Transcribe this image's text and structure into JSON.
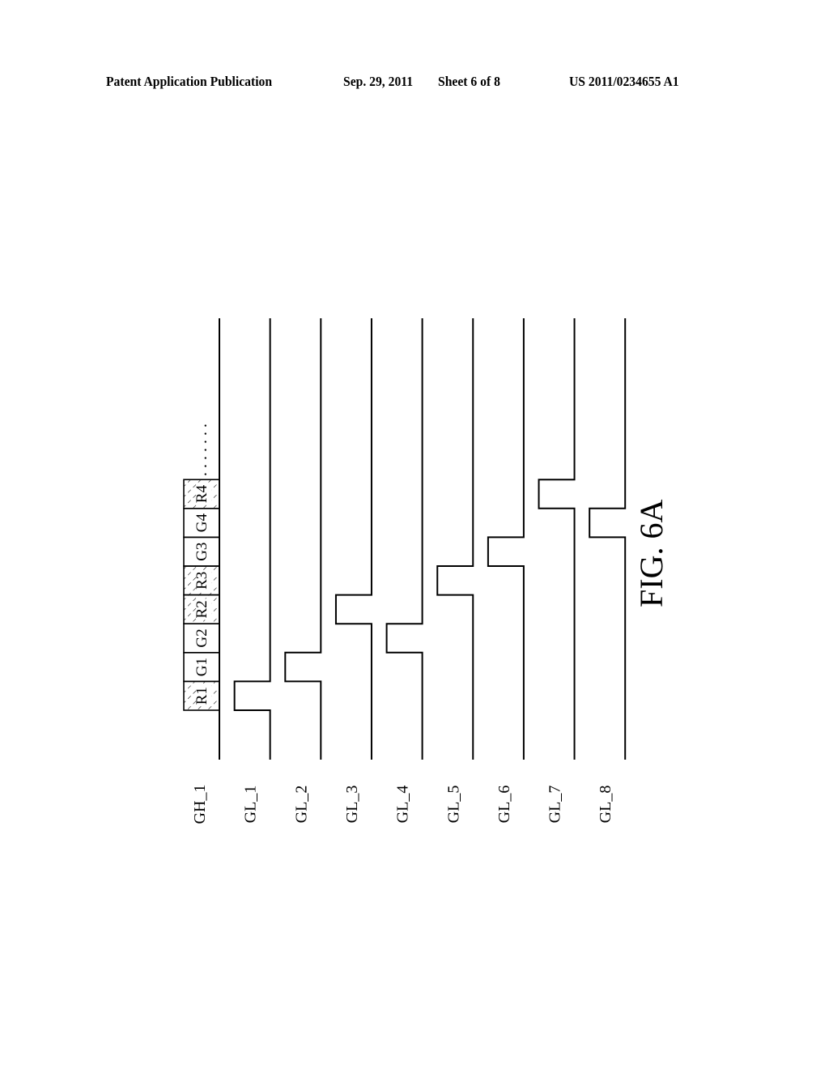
{
  "header": {
    "publication_type": "Patent Application Publication",
    "date": "Sep. 29, 2011",
    "sheet": "Sheet 6 of 8",
    "patent_number": "US 2011/0234655 A1"
  },
  "figure": {
    "caption": "FIG. 6A",
    "gh_slots": [
      {
        "label": "R1",
        "hatched": true
      },
      {
        "label": "G1",
        "hatched": false
      },
      {
        "label": "G2",
        "hatched": false
      },
      {
        "label": "R2",
        "hatched": true
      },
      {
        "label": "R3",
        "hatched": true
      },
      {
        "label": "G3",
        "hatched": false
      },
      {
        "label": "G4",
        "hatched": false
      },
      {
        "label": "R4",
        "hatched": true
      }
    ],
    "continuation": ".......",
    "signals": [
      {
        "name": "GH_1",
        "pulse_slot": null
      },
      {
        "name": "GL_1",
        "pulse_slot": 0
      },
      {
        "name": "GL_2",
        "pulse_slot": 1
      },
      {
        "name": "GL_3",
        "pulse_slot": 3
      },
      {
        "name": "GL_4",
        "pulse_slot": 2
      },
      {
        "name": "GL_5",
        "pulse_slot": 4
      },
      {
        "name": "GL_6",
        "pulse_slot": 5
      },
      {
        "name": "GL_7",
        "pulse_slot": 7
      },
      {
        "name": "GL_8",
        "pulse_slot": 6
      }
    ]
  }
}
